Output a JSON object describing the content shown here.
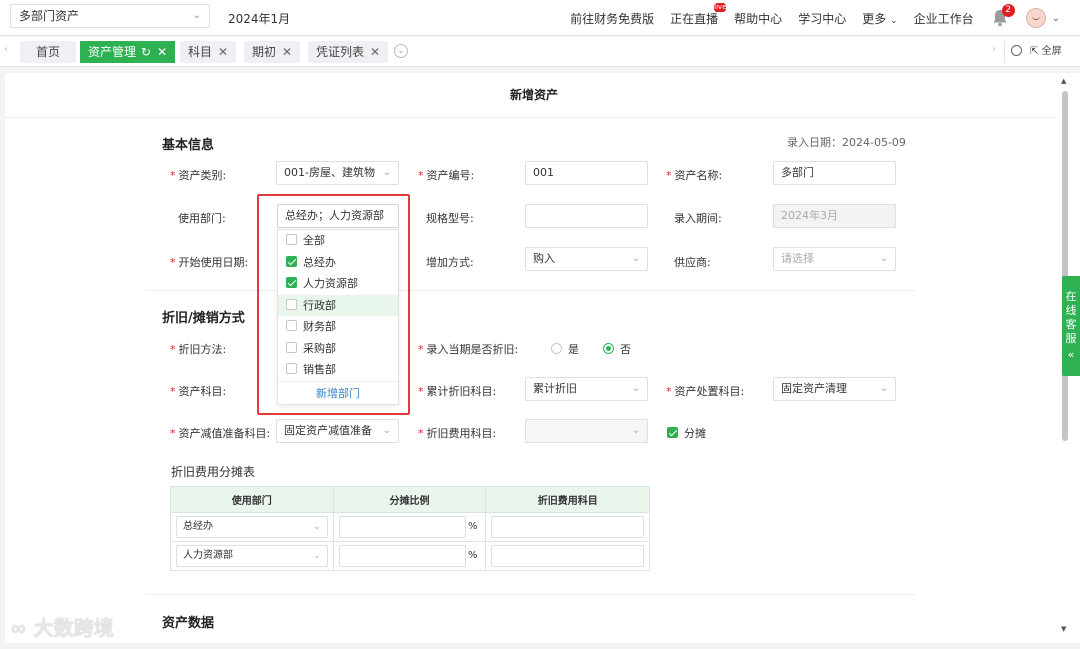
{
  "topbar": {
    "company": "多部门资产",
    "period": "2024年1月",
    "nav": [
      "前往财务免费版",
      "正在直播",
      "帮助中心",
      "学习中心",
      "更多",
      "企业工作台"
    ],
    "live_badge": "live",
    "notification_count": "2"
  },
  "tabs": [
    {
      "label": "首页"
    },
    {
      "label": "资产管理"
    },
    {
      "label": "科目"
    },
    {
      "label": "期初"
    },
    {
      "label": "凭证列表"
    }
  ],
  "fullscreen_label": "全屏",
  "page_title": "新增资产",
  "basic": {
    "section_title": "基本信息",
    "entry_date": "录入日期：2024-05-09",
    "category_label": "资产类别:",
    "category_value": "001-房屋、建筑物",
    "code_label": "资产编号:",
    "code_value": "001",
    "name_label": "资产名称:",
    "name_value": "多部门",
    "dept_label": "使用部门:",
    "dept_value": "总经办；人力资源部",
    "spec_label": "规格型号:",
    "entry_period_label": "录入期间:",
    "entry_period_value": "2024年3月",
    "start_label": "开始使用日期:",
    "add_method_label": "增加方式:",
    "add_method_value": "购入",
    "supplier_label": "供应商:",
    "supplier_placeholder": "请选择"
  },
  "dropdown": {
    "items": [
      {
        "label": "全部",
        "checked": false
      },
      {
        "label": "总经办",
        "checked": true
      },
      {
        "label": "人力资源部",
        "checked": true
      },
      {
        "label": "行政部",
        "checked": false
      },
      {
        "label": "财务部",
        "checked": false
      },
      {
        "label": "采购部",
        "checked": false
      },
      {
        "label": "销售部",
        "checked": false
      }
    ],
    "add_label": "新增部门"
  },
  "depreciation": {
    "section_title": "折旧/摊销方式",
    "method_label": "折旧方法:",
    "current_label": "录入当期是否折旧:",
    "yes": "是",
    "no": "否",
    "asset_subject_label": "资产科目:",
    "accum_label": "累计折旧科目:",
    "accum_value": "累计折旧",
    "disposal_label": "资产处置科目:",
    "disposal_value": "固定资产清理",
    "impair_label": "资产减值准备科目:",
    "impair_value": "固定资产减值准备",
    "expense_label": "折旧费用科目:",
    "allocate_label": "分摊"
  },
  "alloc_table": {
    "title": "折旧费用分摊表",
    "headers": [
      "使用部门",
      "分摊比例",
      "折旧费用科目"
    ],
    "rows": [
      {
        "dept": "总经办",
        "pct_unit": "%"
      },
      {
        "dept": "人力资源部",
        "pct_unit": "%"
      }
    ]
  },
  "asset_data_title": "资产数据",
  "service_label": "在线客服",
  "watermark": "大数跨境"
}
